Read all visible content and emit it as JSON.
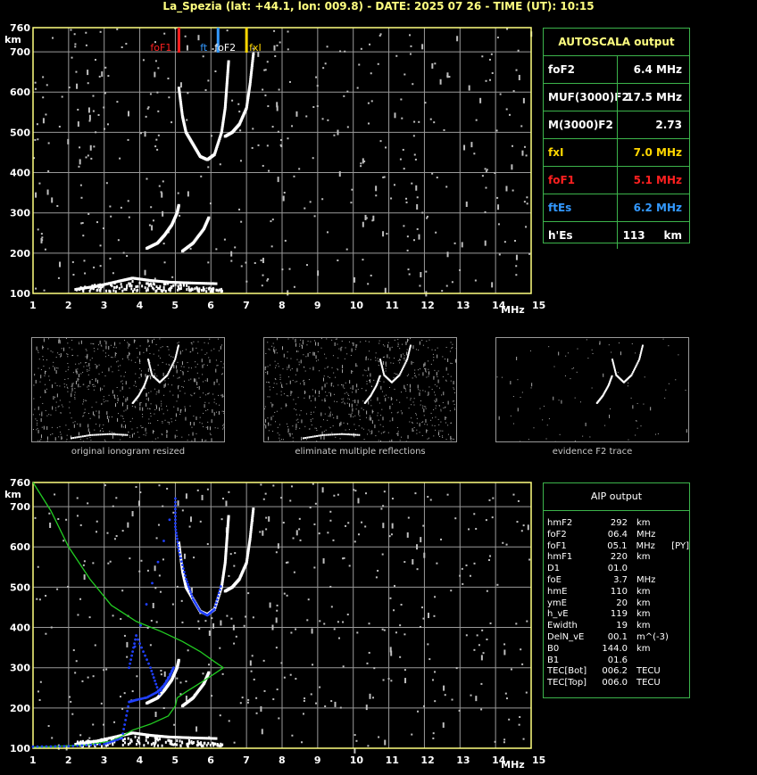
{
  "header": {
    "title": "La_Spezia (lat: +44.1, lon: 009.8) - DATE: 2025 07 26 - TIME (UT): 10:15"
  },
  "colors": {
    "axis": "#ffff80",
    "grid": "#9a9a9a",
    "foF1": "#ff2020",
    "ftEs": "#3399ff",
    "fxI": "#ffd700",
    "green": "#3cb44b",
    "profile": "#22cc22",
    "trace": "#2040ff"
  },
  "top_chart": {
    "markers": [
      {
        "name": "foF1",
        "label": "foF1",
        "freq": 5.1,
        "color": "#ff2020"
      },
      {
        "name": "ftEs",
        "label": "ft",
        "freq": 6.2,
        "color": "#3399ff"
      },
      {
        "name": "foF2",
        "label": "foF2",
        "freq": 6.4,
        "color": "#ffffff"
      },
      {
        "name": "fxI",
        "label": "fxI",
        "freq": 7.0,
        "color": "#ffd700"
      }
    ]
  },
  "chart_data": [
    {
      "type": "scatter",
      "xlabel": "MHz",
      "ylabel": "km",
      "xlim": [
        1,
        15
      ],
      "ylim": [
        100,
        760
      ],
      "x_ticks": [
        "1",
        "2",
        "3",
        "4",
        "5",
        "6",
        "7",
        "8",
        "9",
        "10",
        "11",
        "12",
        "13",
        "14",
        "15"
      ],
      "y_ticks": [
        "760",
        "700",
        "600",
        "500",
        "400",
        "300",
        "200",
        "100"
      ],
      "series": [
        {
          "points": [
            [
              4.2,
              212
            ],
            [
              4.5,
              225
            ],
            [
              4.7,
              245
            ],
            [
              4.9,
              270
            ],
            [
              5.05,
              300
            ],
            [
              5.1,
              320
            ]
          ]
        },
        {
          "points": [
            [
              5.2,
              205
            ],
            [
              5.5,
              225
            ],
            [
              5.8,
              260
            ],
            [
              5.95,
              290
            ]
          ]
        },
        {
          "points": [
            [
              5.1,
              610
            ],
            [
              5.2,
              540
            ],
            [
              5.3,
              500
            ],
            [
              5.5,
              470
            ],
            [
              5.7,
              440
            ],
            [
              5.9,
              432
            ],
            [
              6.1,
              445
            ],
            [
              6.3,
              500
            ],
            [
              6.4,
              560
            ],
            [
              6.45,
              620
            ],
            [
              6.5,
              680
            ]
          ]
        },
        {
          "points": [
            [
              6.4,
              490
            ],
            [
              6.6,
              500
            ],
            [
              6.8,
              520
            ],
            [
              7.0,
              560
            ],
            [
              7.1,
              620
            ],
            [
              7.2,
              700
            ]
          ]
        },
        {
          "points": [
            [
              2.2,
              110
            ],
            [
              2.8,
              118
            ],
            [
              3.4,
              130
            ],
            [
              3.8,
              138
            ],
            [
              4.3,
              132
            ],
            [
              4.8,
              128
            ],
            [
              5.4,
              126
            ],
            [
              6.2,
              124
            ]
          ]
        }
      ]
    },
    {
      "type": "scatter",
      "xlabel": "MHz",
      "ylabel": "km",
      "xlim": [
        1,
        15
      ],
      "ylim": [
        100,
        760
      ],
      "x_ticks": [
        "1",
        "2",
        "3",
        "4",
        "5",
        "6",
        "7",
        "8",
        "9",
        "10",
        "11",
        "12",
        "13",
        "14",
        "15"
      ],
      "y_ticks": [
        "760",
        "700",
        "600",
        "500",
        "400",
        "300",
        "200",
        "100"
      ],
      "series": [
        {
          "points": [
            [
              4.2,
              212
            ],
            [
              4.5,
              225
            ],
            [
              4.7,
              245
            ],
            [
              4.9,
              270
            ],
            [
              5.05,
              300
            ],
            [
              5.1,
              320
            ]
          ]
        },
        {
          "points": [
            [
              5.2,
              205
            ],
            [
              5.5,
              225
            ],
            [
              5.8,
              260
            ],
            [
              5.95,
              290
            ]
          ]
        },
        {
          "points": [
            [
              5.1,
              610
            ],
            [
              5.2,
              540
            ],
            [
              5.3,
              500
            ],
            [
              5.5,
              470
            ],
            [
              5.7,
              440
            ],
            [
              5.9,
              432
            ],
            [
              6.1,
              445
            ],
            [
              6.3,
              500
            ],
            [
              6.4,
              560
            ],
            [
              6.45,
              620
            ],
            [
              6.5,
              680
            ]
          ]
        },
        {
          "points": [
            [
              6.4,
              490
            ],
            [
              6.6,
              500
            ],
            [
              6.8,
              520
            ],
            [
              7.0,
              560
            ],
            [
              7.1,
              620
            ],
            [
              7.2,
              700
            ]
          ]
        },
        {
          "points": [
            [
              2.2,
              110
            ],
            [
              2.8,
              118
            ],
            [
              3.4,
              130
            ],
            [
              3.8,
              138
            ],
            [
              4.3,
              132
            ],
            [
              4.8,
              128
            ],
            [
              5.4,
              126
            ],
            [
              6.2,
              124
            ]
          ]
        }
      ],
      "profile": [
        [
          1,
          760
        ],
        [
          1.5,
          690
        ],
        [
          2,
          600
        ],
        [
          2.6,
          520
        ],
        [
          3.2,
          455
        ],
        [
          3.9,
          415
        ],
        [
          4.6,
          390
        ],
        [
          5.2,
          365
        ],
        [
          5.7,
          340
        ],
        [
          6.1,
          315
        ],
        [
          6.35,
          300
        ],
        [
          6.1,
          285
        ],
        [
          5.7,
          262
        ],
        [
          5.3,
          240
        ],
        [
          5.05,
          225
        ],
        [
          5.0,
          205
        ],
        [
          4.8,
          180
        ],
        [
          4.3,
          160
        ],
        [
          3.8,
          145
        ],
        [
          3.5,
          130
        ],
        [
          3.2,
          118
        ],
        [
          2.5,
          108
        ],
        [
          1.5,
          104
        ],
        [
          1,
          103
        ]
      ],
      "trace": [
        [
          1,
          104
        ],
        [
          2,
          105
        ],
        [
          3,
          110
        ],
        [
          3.5,
          125
        ],
        [
          3.7,
          215
        ],
        [
          3.9,
          220
        ],
        [
          4.2,
          226
        ],
        [
          4.5,
          240
        ],
        [
          4.7,
          258
        ],
        [
          4.85,
          280
        ],
        [
          4.95,
          300
        ],
        [
          4.55,
          235
        ],
        [
          4.3,
          300
        ],
        [
          3.9,
          380
        ],
        [
          3.7,
          300
        ],
        [
          5.0,
          720
        ],
        [
          5.0,
          650
        ],
        [
          5.1,
          590
        ],
        [
          5.3,
          520
        ],
        [
          5.5,
          470
        ],
        [
          5.7,
          440
        ],
        [
          5.9,
          430
        ],
        [
          6.1,
          445
        ],
        [
          6.3,
          510
        ]
      ]
    }
  ],
  "thumbnails": [
    {
      "caption": "original ionogram resized"
    },
    {
      "caption": "eliminate multiple reflections"
    },
    {
      "caption": "evidence F2 trace"
    }
  ],
  "autoscala": {
    "title": "AUTOSCALA output",
    "rows": [
      {
        "label": "foF2",
        "value": "6.4 MHz",
        "color": "#ffffff"
      },
      {
        "label": "MUF(3000)F2",
        "value": "17.5 MHz",
        "color": "#ffffff"
      },
      {
        "label": "M(3000)F2",
        "value": "2.73",
        "color": "#ffffff"
      },
      {
        "label": "fxI",
        "value": "7.0 MHz",
        "color": "#ffd700"
      },
      {
        "label": "foF1",
        "value": "5.1 MHz",
        "color": "#ff2020"
      },
      {
        "label": "ftEs",
        "value": "6.2 MHz",
        "color": "#3399ff"
      },
      {
        "label": "h'Es",
        "value": "113     km",
        "color": "#ffffff"
      }
    ]
  },
  "aip": {
    "title": "AIP output",
    "rows": [
      {
        "n": "hmF2",
        "v": "292",
        "u": "km",
        "x": ""
      },
      {
        "n": "foF2",
        "v": "06.4",
        "u": "MHz",
        "x": ""
      },
      {
        "n": "foF1",
        "v": "05.1",
        "u": "MHz",
        "x": "[PY]"
      },
      {
        "n": "hmF1",
        "v": "220",
        "u": "km",
        "x": ""
      },
      {
        "n": "D1",
        "v": "01.0",
        "u": "",
        "x": ""
      },
      {
        "n": "foE",
        "v": "3.7",
        "u": "MHz",
        "x": ""
      },
      {
        "n": "hmE",
        "v": "110",
        "u": "km",
        "x": ""
      },
      {
        "n": "ymE",
        "v": "20",
        "u": "km",
        "x": ""
      },
      {
        "n": "h_vE",
        "v": "119",
        "u": "km",
        "x": ""
      },
      {
        "n": "Ewidth",
        "v": "19",
        "u": "km",
        "x": ""
      },
      {
        "n": "DelN_vE",
        "v": "00.1",
        "u": "m^(-3)",
        "x": ""
      },
      {
        "n": "B0",
        "v": "144.0",
        "u": "km",
        "x": ""
      },
      {
        "n": "B1",
        "v": "01.6",
        "u": "",
        "x": ""
      },
      {
        "n": "TEC[Bot]",
        "v": "006.2",
        "u": "TECU",
        "x": ""
      },
      {
        "n": "TEC[Top]",
        "v": "006.0",
        "u": "TECU",
        "x": ""
      }
    ]
  }
}
